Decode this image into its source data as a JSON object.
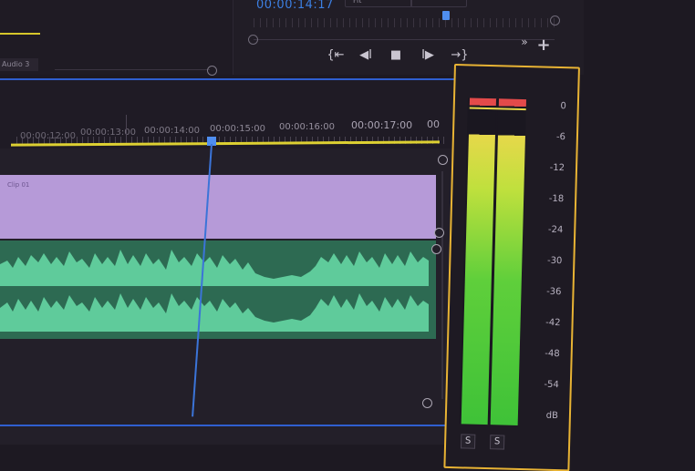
{
  "program_monitor": {
    "timecode": "00:00:14:17",
    "fit_label": "Fit",
    "audio_track_label": "Audio 3",
    "transport": {
      "mark_in": "{⇤",
      "step_back": "◀I",
      "stop": "■",
      "play": "I▶",
      "mark_out": "→}",
      "more": "»",
      "add": "+"
    }
  },
  "timeline": {
    "ruler_labels": [
      "00:00:12:00",
      "00:00:13:00",
      "00:00:14:00",
      "00:00:15:00",
      "00:00:16:00",
      "00:00:17:00",
      "00"
    ],
    "video_clip_name": "Clip 01",
    "playhead_color": "#3b74d8",
    "work_area_color": "#ddd032",
    "clip_color": "#b69ad8",
    "audio_color": "#5fcb9b"
  },
  "audio_meter": {
    "db_labels": [
      "0",
      "-6",
      "-12",
      "-18",
      "-24",
      "-30",
      "-36",
      "-42",
      "-48",
      "-54",
      "dB"
    ],
    "solo_left": "S",
    "solo_right": "S",
    "border_color": "#e8b334"
  }
}
